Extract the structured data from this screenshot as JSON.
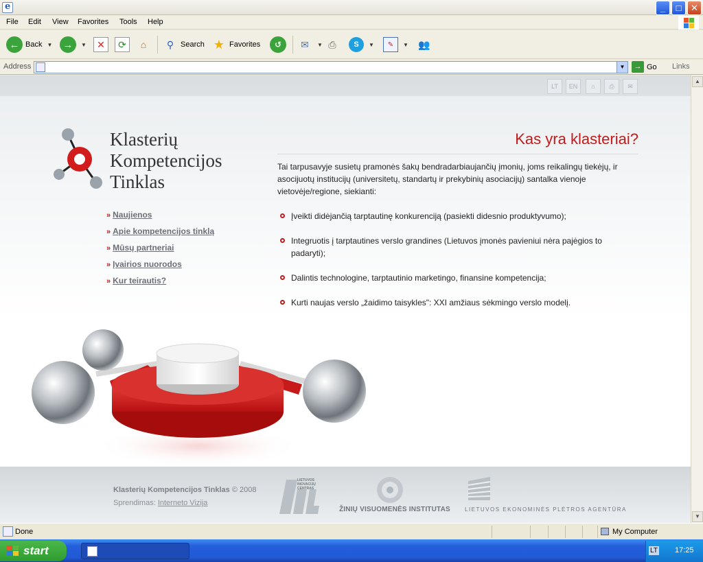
{
  "window": {
    "controls": {
      "minimize": "_",
      "maximize": "□",
      "close": "✕"
    }
  },
  "menu": {
    "items": [
      "File",
      "Edit",
      "View",
      "Favorites",
      "Tools",
      "Help"
    ]
  },
  "toolbar": {
    "back_label": "Back",
    "search_label": "Search",
    "favorites_label": "Favorites"
  },
  "addressbar": {
    "label": "Address",
    "value": "",
    "go_label": "Go",
    "links_label": "Links"
  },
  "page": {
    "top_buttons": [
      "LT",
      "EN"
    ],
    "logo": {
      "line1": "Klasterių",
      "line2": "Kompetencijos",
      "line3": "Tinklas"
    },
    "nav": [
      "Naujienos",
      "Apie kompetencijos tinklą",
      "Mūsų partneriai",
      "Įvairios nuorodos",
      "Kur teirautis?"
    ],
    "nav_bullet": "»",
    "headline": "Kas yra klasteriai?",
    "intro": "Tai tarpusavyje susietų pramonės šakų bendradarbiaujančių įmonių, joms reikalingų tiekėjų, ir asocijuotų institucijų (universitetų, standartų ir prekybinių asociacijų) santalka vienoje vietovėje/regione, siekianti:",
    "goals": [
      "Įveikti didėjančią tarptautinę konkurenciją (pasiekti didesnio produktyvumo);",
      "Integruotis į tarptautines verslo grandines (Lietuvos įmonės pavieniui nėra pajėgios to padaryti);",
      "Dalintis technologine, tarptautinio marketingo, finansine kompetencija;",
      "Kurti naujas verslo „žaidimo taisykles\": XXI amžiaus sėkmingo verslo modelį."
    ],
    "footer": {
      "org": "Klasterių Kompetencijos Tinklas",
      "year": "© 2008",
      "solution_label": "Sprendimas:",
      "solution_link": "Interneto Vizija"
    },
    "partners": {
      "lic_small": "LIETUVOS INOVACIJŲ CENTRAS",
      "zinv": "ŽINIŲ VISUOMENĖS INSTITUTAS",
      "lepa": "LIETUVOS EKONOMINĖS PLĖTROS AGENTŪRA"
    }
  },
  "statusbar": {
    "text": "Done",
    "zone": "My Computer"
  },
  "taskbar": {
    "start_label": "start",
    "language": "LT",
    "clock": "17:25"
  },
  "colors": {
    "accent_red": "#c41a1a",
    "nav_link": "#6e6e78",
    "xp_blue": "#245edb"
  }
}
